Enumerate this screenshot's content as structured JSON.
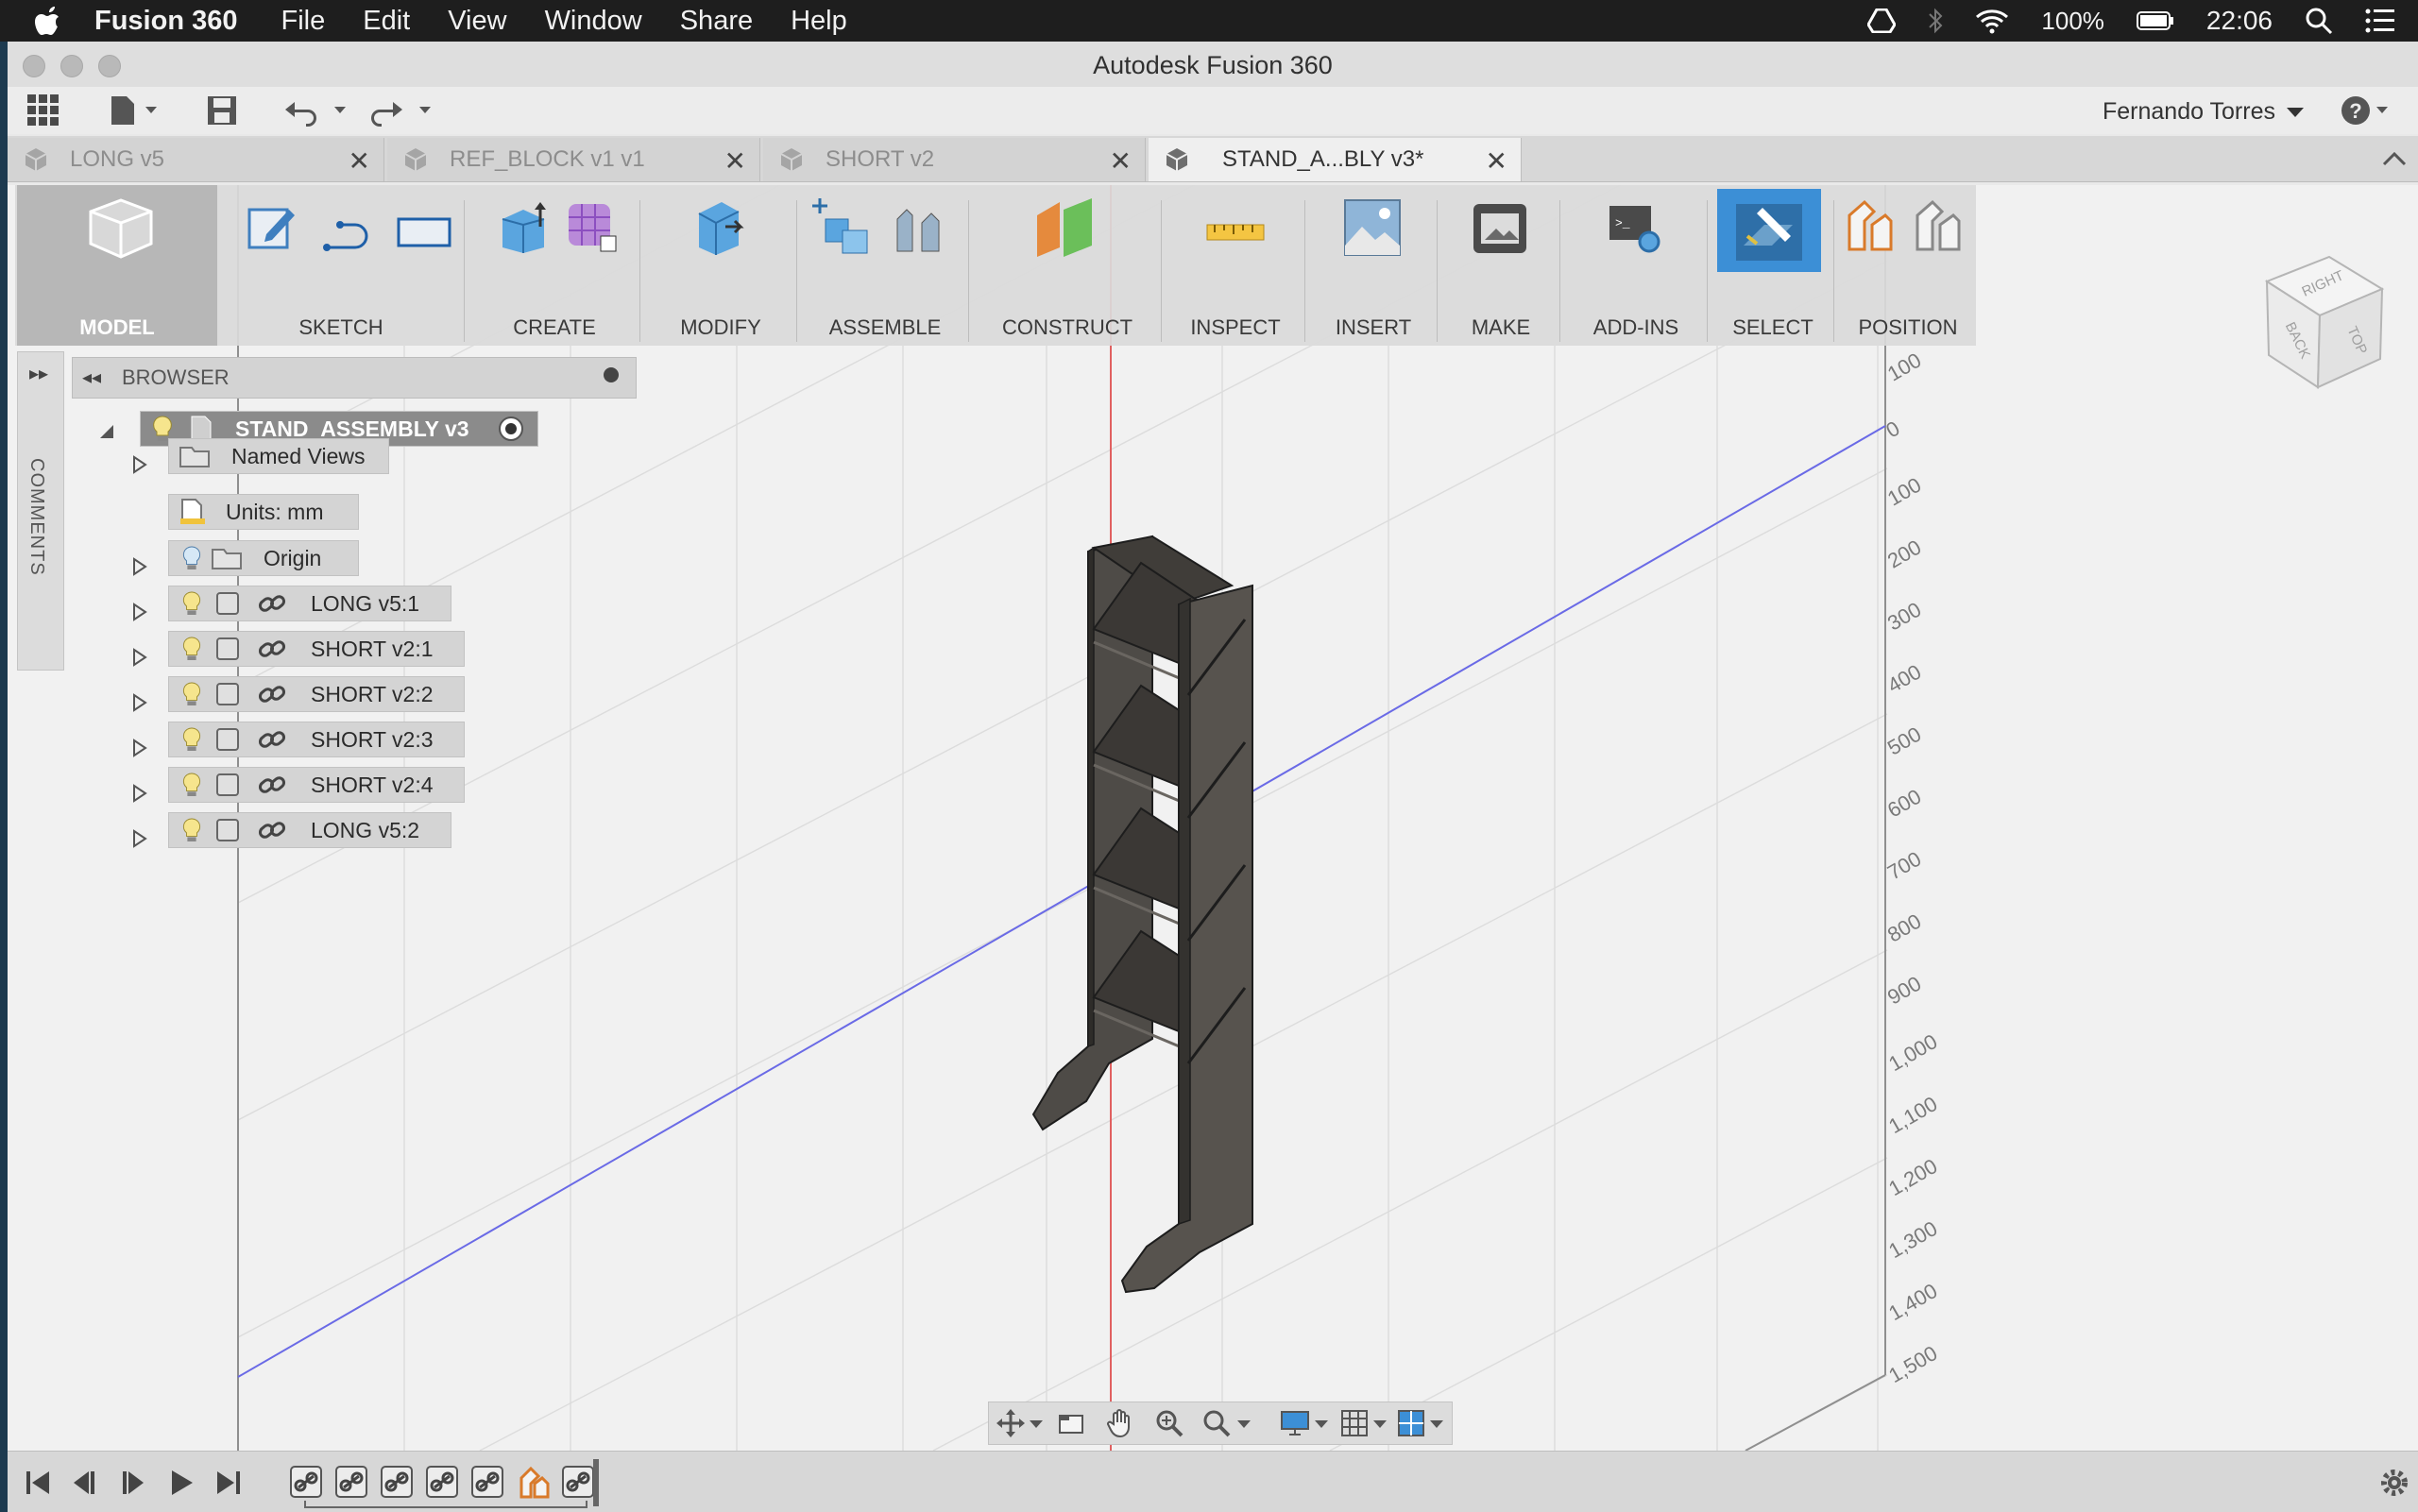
{
  "menubar": {
    "app_name": "Fusion 360",
    "items": [
      "File",
      "Edit",
      "View",
      "Window",
      "Share",
      "Help"
    ],
    "battery": "100%",
    "clock": "22:06"
  },
  "window": {
    "title": "Autodesk Fusion 360",
    "user": "Fernando Torres"
  },
  "tabs": [
    {
      "label": "LONG v5",
      "active": false
    },
    {
      "label": "REF_BLOCK v1 v1",
      "active": false
    },
    {
      "label": "SHORT v2",
      "active": false
    },
    {
      "label": "STAND_A...BLY v3*",
      "active": true
    }
  ],
  "toolbar": {
    "workspace": "MODEL",
    "groups": [
      "SKETCH",
      "CREATE",
      "MODIFY",
      "ASSEMBLE",
      "CONSTRUCT",
      "INSPECT",
      "INSERT",
      "MAKE",
      "ADD-INS",
      "SELECT",
      "POSITION"
    ]
  },
  "comments_label": "COMMENTS",
  "browser": {
    "title": "BROWSER",
    "root": "STAND_ASSEMBLY v3",
    "items": [
      "Named Views",
      "Units: mm",
      "Origin",
      "LONG v5:1",
      "SHORT v2:1",
      "SHORT v2:2",
      "SHORT v2:3",
      "SHORT v2:4",
      "LONG v5:2"
    ]
  },
  "viewcube": {
    "faces": [
      "RIGHT",
      "BACK",
      "TOP"
    ]
  },
  "ruler": [
    "100",
    "0",
    "100",
    "200",
    "300",
    "400",
    "500",
    "600",
    "700",
    "800",
    "900",
    "1,000",
    "1,100",
    "1,200",
    "1,300",
    "1,400",
    "1,500"
  ],
  "colors": {
    "accent": "#3c8fd6",
    "x_axis": "#e06060",
    "y_axis": "#6a6ae6",
    "model": "#4e4b47"
  }
}
